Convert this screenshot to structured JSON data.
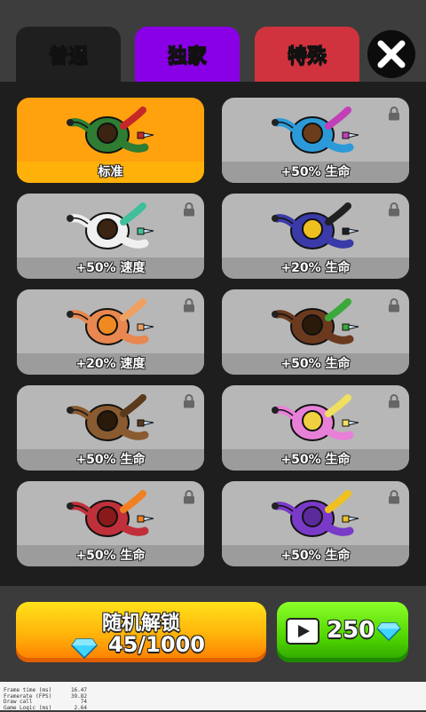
{
  "tabs": [
    {
      "label": "普通",
      "color": "#1f1f1f"
    },
    {
      "label": "独家",
      "color": "#8a00e6"
    },
    {
      "label": "特殊",
      "color": "#d0333d"
    }
  ],
  "close_icon": "close-x-icon",
  "skins": [
    {
      "label": "标准",
      "selected": true,
      "locked": false,
      "body": "#2e7d32",
      "accent": "#c62828",
      "hair": "#3b2412"
    },
    {
      "label": "+50% 生命",
      "selected": false,
      "locked": true,
      "body": "#2c9ad8",
      "accent": "#c23fb8",
      "hair": "#6b3d1c"
    },
    {
      "label": "+50% 速度",
      "selected": false,
      "locked": true,
      "body": "#f0f0f0",
      "accent": "#3fbf9a",
      "hair": "#3b2412"
    },
    {
      "label": "+20% 生命",
      "selected": false,
      "locked": true,
      "body": "#3a3aa8",
      "accent": "#202020",
      "hair": "#f0c020"
    },
    {
      "label": "+20% 速度",
      "selected": false,
      "locked": true,
      "body": "#e8874f",
      "accent": "#f0a060",
      "hair": "#f08a20"
    },
    {
      "label": "+50% 生命",
      "selected": false,
      "locked": true,
      "body": "#6b3a1e",
      "accent": "#3aa83a",
      "hair": "#2a1a0a"
    },
    {
      "label": "+50% 生命",
      "selected": false,
      "locked": true,
      "body": "#8a5a30",
      "accent": "#5a3a1a",
      "hair": "#2a1a0a"
    },
    {
      "label": "+50% 生命",
      "selected": false,
      "locked": true,
      "body": "#e880d8",
      "accent": "#f0e060",
      "hair": "#f0d040"
    },
    {
      "label": "+50% 生命",
      "selected": false,
      "locked": true,
      "body": "#c0303a",
      "accent": "#f08020",
      "hair": "#8a1a1a"
    },
    {
      "label": "+50% 生命",
      "selected": false,
      "locked": true,
      "body": "#7a3ac8",
      "accent": "#f0c020",
      "hair": "#5a2a9a"
    }
  ],
  "random_unlock": {
    "title": "随机解锁",
    "progress": "45/1000",
    "icon": "gem-icon"
  },
  "video_reward": {
    "icon": "video-play-icon",
    "amount": "250",
    "currency_icon": "gem-icon"
  },
  "debug": [
    {
      "label": "Frame time (ms)",
      "value": "16.47"
    },
    {
      "label": "Framerate (FPS)",
      "value": "39.82"
    },
    {
      "label": "Draw call",
      "value": "74"
    },
    {
      "label": "Game Logic (ms)",
      "value": "2.64"
    }
  ]
}
